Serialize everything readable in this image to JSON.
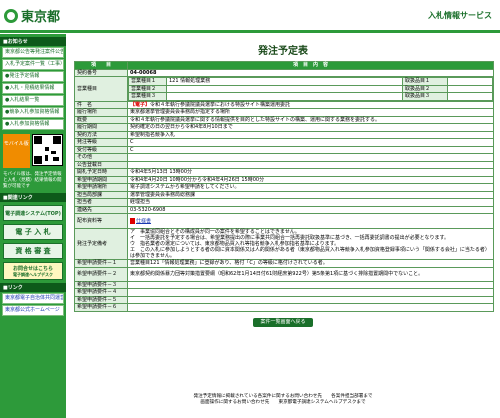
{
  "header": {
    "logo_text": "東京都",
    "service_title": "入札情報サービス"
  },
  "sidebar": {
    "menu_heading": "■お知らせ",
    "menu_items": [
      "東京都公告等発注案件公告",
      "入札予定案件一覧（工事）",
      "●発注予定情報",
      "●入札・見積結果情報",
      "●入札結果一覧",
      "●競争入札参加資格情報",
      "●入札参加資格情報"
    ],
    "link_heading": "■関連リンク",
    "btn_system": "電子調達システム(TOP)",
    "btn_denshi": "電 子 入 札",
    "btn_shikaku": "資 格 審 査",
    "btn_help": "お問合せはこちら",
    "help_sub": "電子調達ヘルプデスク",
    "mobile_label": "モバイル版",
    "mobile_note": "モバイル版は、発注予定情報と入札（見積）結果情報の閲覧が可能です",
    "link_heading2": "■リンク",
    "link1": "東京都電子自治体共同運営",
    "link2": "東京都公式ホームページ"
  },
  "page_title": "発注予定表",
  "table": {
    "col_item": "項　　目",
    "col_content": "項　目　内　容",
    "rows": {
      "contract_no_label": "契約番号",
      "contract_no": "04-00068",
      "biz_type_label": "営業種目",
      "biz1_label": "営業種目１",
      "biz1_value": "121 情報処理業務",
      "biz2_label": "営業種目２",
      "biz3_label": "営業種目３",
      "rank1_label": "取扱品目１",
      "rank2_label": "取扱品目２",
      "rank3_label": "取扱品目３",
      "name_label": "件　名",
      "name_tag": "【電子】",
      "name_value": "令和４年執行参議院議員選挙における特設サイト構築運用委託",
      "place_label": "履行場所",
      "place_value": "東京都選挙管理委員会事務局が指定する場所",
      "summary_label": "概要",
      "summary_value": "令和４年執行参議院議員選挙に関する情報提供を目的とした特設サイトの構築、運用に関する業務を委託する。",
      "period_label": "履行期間",
      "period_value": "契約確定の日の翌日から令和4年8月10日まで",
      "method_label": "契約方法",
      "method_value": "希望制指名競争入札",
      "class_label": "発注等級",
      "class_value": "C",
      "accept_label": "受付等級",
      "accept_value": "C",
      "other_label": "その他",
      "other_value": "",
      "date_label": "公告登載日",
      "date_value": "",
      "open_label": "開札予定日時",
      "open_value": "令和4年5月13日 13時00分",
      "apply_label": "希望申請期間",
      "apply_value": "令和4年4月20日 10時00分から令和4年4月26日 15時00分",
      "apply_method_label": "希望申請場所",
      "apply_method_value": "電子調達システムから希望申請をしてください。",
      "dept_label": "担当局部課",
      "dept_value": "選挙管理委員会事務局総務課",
      "person_label": "担当者",
      "person_value": "経理担当",
      "tel_label": "連絡先",
      "tel_value": "03-5320-6908",
      "doc_label": "配布資料等",
      "doc_value": "仕様書",
      "plan_label": "発注予定備考",
      "plan_lines": [
        "ア　事業協同組合とその構成員が同一の案件を希望することはできません。",
        "イ　一括再委託を予定する場合は、希望業務提出の際に事業共同組合一括再委託取扱基準に基づき、一括再委託調書の提出が必要となります。",
        "ウ　指名業者の選定については、東京都物品買入れ等指名競争入札参加指名基準によります。",
        "エ　この入札に参加しようとする者の間に資本関係又は人的関係がある者（東京都物品買入れ等競争入札参加資格登録事項にいう「関係する会社」に当たる者）は参加できません。"
      ],
      "req1_label": "希望申請要件－１",
      "req1_value": "営業種目121「情報処理業務」に登録があり、格付「C」の等級に格付けされている者。",
      "req2_label": "希望申請要件－２",
      "req2_value": "東京都契約関係暴力団等対策措置要綱（昭和62年1月14日付61財経庶第922号）第5条第1項に基づく排除措置期間中でないこと。",
      "req3_label": "希望申請要件－３",
      "req4_label": "希望申請要件－４",
      "req5_label": "希望申請要件－５",
      "req6_label": "希望申請要件－６"
    }
  },
  "back_button": "案件一覧画面へ戻る",
  "footer": {
    "line1": "発注予定情報に掲載されている各案件に関するお問い合わせ先　　各案件担当部署まで",
    "line2": "画面操作に関するお問い合わせ先　　東京都電子調達システムヘルプデスクまで"
  }
}
